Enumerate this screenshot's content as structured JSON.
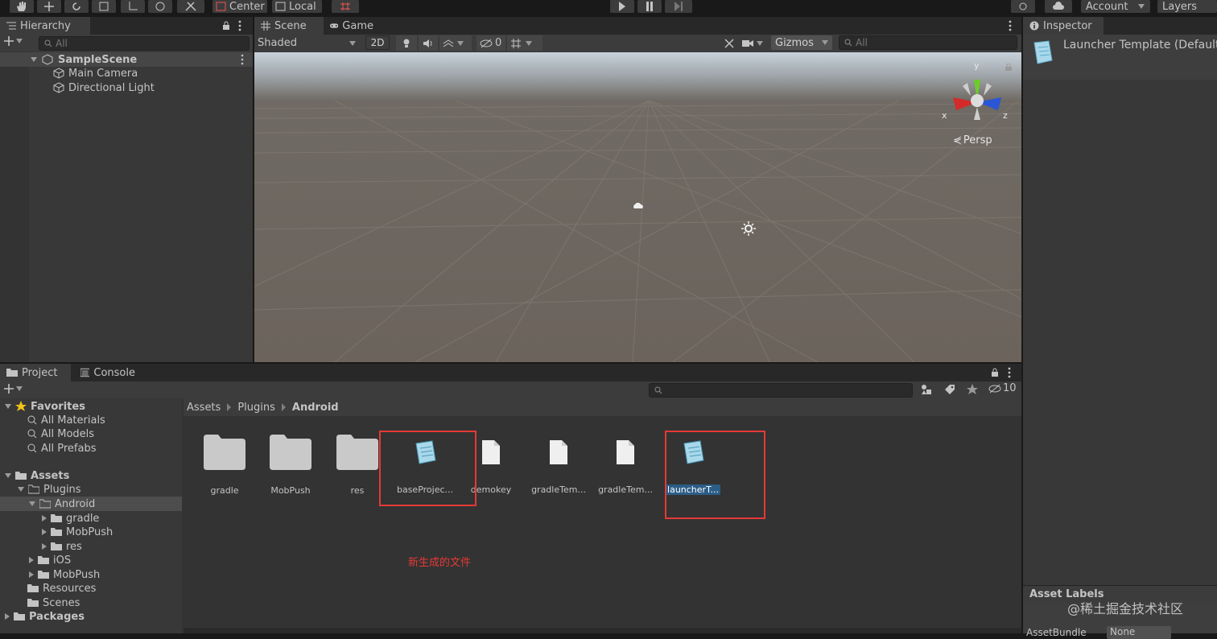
{
  "toolbar": {
    "pivot_mode": "Center",
    "pivot_rotation": "Local",
    "account_label": "Account",
    "layers_label": "Layers"
  },
  "hierarchy": {
    "tab_label": "Hierarchy",
    "search_placeholder": "All",
    "scene_name": "SampleScene",
    "items": [
      {
        "label": "Main Camera"
      },
      {
        "label": "Directional Light"
      }
    ]
  },
  "scene_view": {
    "tabs": [
      {
        "label": "Scene"
      },
      {
        "label": "Game"
      }
    ],
    "shading_mode": "Shaded",
    "mode_2d": "2D",
    "hidden_count": "0",
    "gizmos_label": "Gizmos",
    "search_placeholder": "All",
    "projection_label": "Persp",
    "axis_labels": {
      "x": "x",
      "y": "y",
      "z": "z"
    }
  },
  "inspector": {
    "tab_label": "Inspector",
    "title": "Launcher Template (Default",
    "asset_labels_header": "Asset Labels",
    "asset_bundle_label": "AssetBundle",
    "asset_bundle_value": "None"
  },
  "project": {
    "tabs": [
      {
        "label": "Project"
      },
      {
        "label": "Console"
      }
    ],
    "hidden_count": "10",
    "favorites": {
      "label": "Favorites",
      "items": [
        {
          "label": "All Materials"
        },
        {
          "label": "All Models"
        },
        {
          "label": "All Prefabs"
        }
      ]
    },
    "tree": {
      "assets": "Assets",
      "plugins": "Plugins",
      "android": "Android",
      "android_children": [
        {
          "label": "gradle"
        },
        {
          "label": "MobPush"
        },
        {
          "label": "res"
        }
      ],
      "ios": "iOS",
      "mobpush": "MobPush",
      "resources": "Resources",
      "scenes": "Scenes",
      "packages": "Packages"
    },
    "breadcrumb": [
      "Assets",
      "Plugins",
      "Android"
    ],
    "assets": [
      {
        "label": "gradle",
        "kind": "folder"
      },
      {
        "label": "MobPush",
        "kind": "folder"
      },
      {
        "label": "res",
        "kind": "folder"
      },
      {
        "label": "baseProjec...",
        "kind": "template"
      },
      {
        "label": "demokey",
        "kind": "file"
      },
      {
        "label": "gradleTem...",
        "kind": "file"
      },
      {
        "label": "gradleTem...",
        "kind": "file"
      },
      {
        "label": "launcherT...",
        "kind": "template",
        "selected": true
      }
    ],
    "annotation": "新生成的文件",
    "annotation_color": "#e53935"
  },
  "watermark": "@稀土掘金技术社区",
  "colors": {
    "selection": "#2c5d87",
    "accent_green": "#6ccc2a",
    "gizmo_red": "#d52a2a",
    "gizmo_blue": "#2a55d5"
  }
}
